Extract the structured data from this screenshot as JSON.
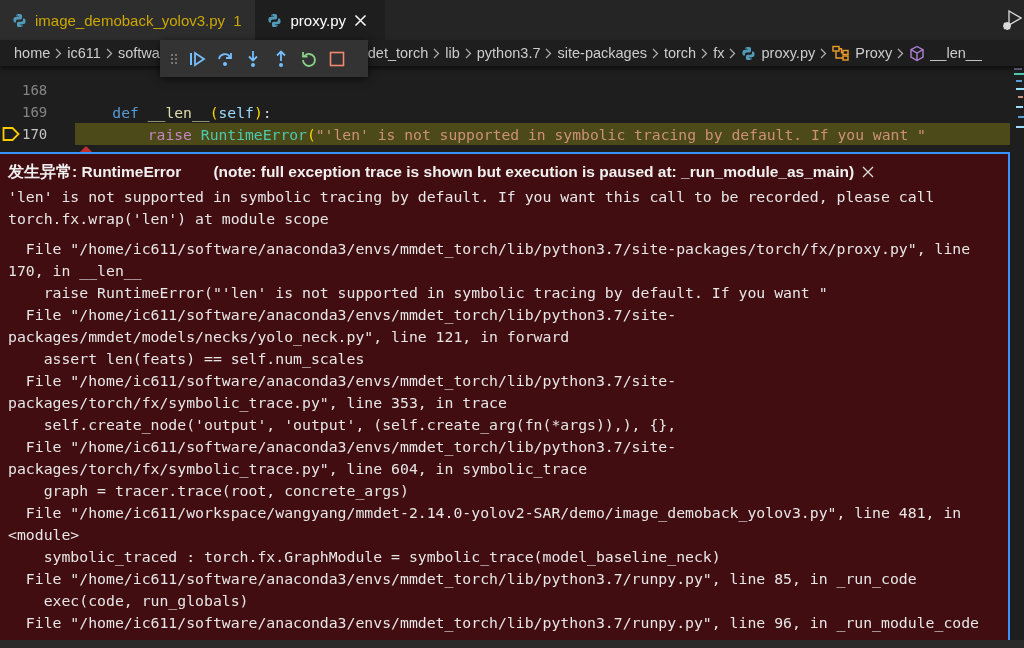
{
  "tabs": [
    {
      "label": "image_demoback_yolov3.py",
      "problems": "1",
      "selected": false
    },
    {
      "label": "proxy.py",
      "selected": true
    }
  ],
  "breadcrumb_left": [
    {
      "label": "home"
    },
    {
      "label": "ic611"
    },
    {
      "label": "softwa"
    }
  ],
  "breadcrumb_right": [
    {
      "label": "det_torch"
    },
    {
      "label": "lib"
    },
    {
      "label": "python3.7"
    },
    {
      "label": "site-packages"
    },
    {
      "label": "torch"
    },
    {
      "label": "fx"
    },
    {
      "label": "proxy.py",
      "kind": "file"
    },
    {
      "label": "Proxy",
      "kind": "class"
    },
    {
      "label": "__len__",
      "kind": "method"
    }
  ],
  "debug_toolbar": {
    "buttons": [
      {
        "kind": "continue"
      },
      {
        "kind": "step_over"
      },
      {
        "kind": "step_into"
      },
      {
        "kind": "step_out"
      },
      {
        "kind": "restart"
      },
      {
        "kind": "stop"
      }
    ]
  },
  "editor": {
    "lines": [
      {
        "number": "168",
        "current": false
      },
      {
        "number": "169",
        "current": false,
        "tokens": [
          {
            "text": "    def",
            "kind": "keyword"
          },
          {
            "text": " __len__",
            "kind": "function"
          },
          {
            "text": "(",
            "kind": "paren"
          },
          {
            "text": "self",
            "kind": "param"
          },
          {
            "text": ")",
            "kind": "paren"
          },
          {
            "text": ":",
            "kind": "plain"
          }
        ]
      },
      {
        "number": "170",
        "current": true,
        "tokens": [
          {
            "text": "        raise",
            "kind": "control"
          },
          {
            "text": " RuntimeError",
            "kind": "class"
          },
          {
            "text": "(",
            "kind": "paren"
          },
          {
            "text": "\"'len' is not supported in symbolic tracing by default. If you want \"",
            "kind": "string"
          }
        ]
      }
    ]
  },
  "exception": {
    "title": "发生异常: RuntimeError",
    "note": "(note: full exception trace is shown but execution is paused at: _run_module_as_main)",
    "message": [
      "'len' is not supported in symbolic tracing by default. If you want this call to be recorded, please call",
      "torch.fx.wrap('len') at module scope"
    ],
    "trace": [
      "  File \"/home/ic611/software/anaconda3/envs/mmdet_torch/lib/python3.7/site-packages/torch/fx/proxy.py\", line",
      "170, in __len__",
      "    raise RuntimeError(\"'len' is not supported in symbolic tracing by default. If you want \"",
      "  File \"/home/ic611/software/anaconda3/envs/mmdet_torch/lib/python3.7/site-",
      "packages/mmdet/models/necks/yolo_neck.py\", line 121, in forward",
      "    assert len(feats) == self.num_scales",
      "  File \"/home/ic611/software/anaconda3/envs/mmdet_torch/lib/python3.7/site-",
      "packages/torch/fx/symbolic_trace.py\", line 353, in trace",
      "    self.create_node('output', 'output', (self.create_arg(fn(*args)),), {},",
      "  File \"/home/ic611/software/anaconda3/envs/mmdet_torch/lib/python3.7/site-",
      "packages/torch/fx/symbolic_trace.py\", line 604, in symbolic_trace",
      "    graph = tracer.trace(root, concrete_args)",
      "  File \"/home/ic611/workspace/wangyang/mmdet-2.14.0-yolov2-SAR/demo/image_demoback_yolov3.py\", line 481, in",
      "<module>",
      "    symbolic_traced : torch.fx.GraphModule = symbolic_trace(model_baseline_neck)",
      "  File \"/home/ic611/software/anaconda3/envs/mmdet_torch/lib/python3.7/runpy.py\", line 85, in _run_code",
      "    exec(code, run_globals)",
      "  File \"/home/ic611/software/anaconda3/envs/mmdet_torch/lib/python3.7/runpy.py\", line 96, in _run_module_code"
    ]
  }
}
